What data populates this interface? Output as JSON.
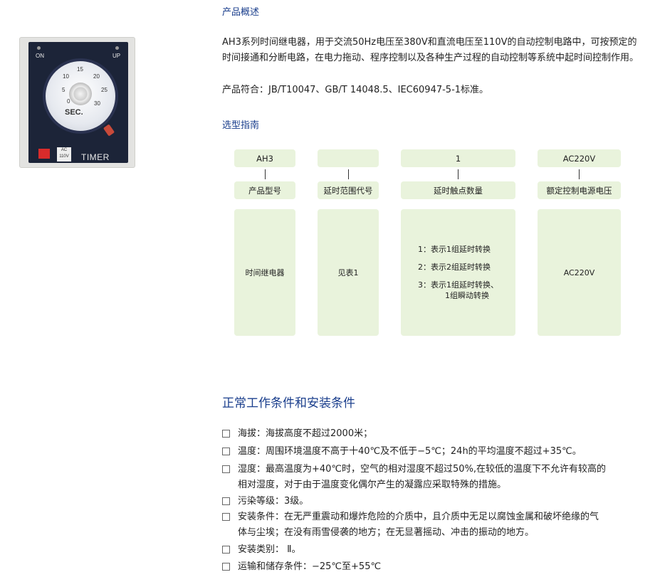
{
  "overview": {
    "heading": "产品概述",
    "description": "AH3系列时间继电器，用于交流50Hz电压至380V和直流电压至110V的自动控制电路中，可按预定的时间接通和分断电路，在电力拖动、程序控制以及各种生产过程的自动控制等系统中起时间控制作用。",
    "standards": "产品符合：JB/T10047、GB/T 14048.5、IEC60947-5-1标准。"
  },
  "product_image": {
    "on_label": "ON",
    "up_label": "UP",
    "dial_numbers": [
      "0",
      "5",
      "10",
      "15",
      "20",
      "25",
      "30"
    ],
    "unit_label": "SEC.",
    "voltage_label": "AC 110V",
    "timer_label": "TIMER"
  },
  "guide": {
    "heading": "选型指南",
    "columns": [
      {
        "code": "AH3",
        "name": "产品型号",
        "detail_lines": [
          "时间继电器"
        ]
      },
      {
        "code": "",
        "name": "延时范围代号",
        "detail_lines": [
          "见表1"
        ]
      },
      {
        "code": "1",
        "name": "延时触点数量",
        "detail_lines": [
          "1：表示1组延时转换",
          "2：表示2组延时转换",
          "3：表示1组延时转换、",
          "1组瞬动转换"
        ]
      },
      {
        "code": "AC220V",
        "name": "额定控制电源电压",
        "detail_lines": [
          "AC220V"
        ]
      }
    ]
  },
  "conditions": {
    "heading": "正常工作条件和安装条件",
    "items": [
      {
        "line1": "海拔：海拔高度不超过2000米；",
        "line2": ""
      },
      {
        "line1": "温度：周围环境温度不高于十40℃及不低于−5℃；24h的平均温度不超过+35℃。",
        "line2": ""
      },
      {
        "line1": "湿度：最高温度为+40℃时，空气的相对湿度不超过50%,在较低的温度下不允许有较高的",
        "line2": "相对湿度，对于由于温度变化偶尔产生的凝露应采取特殊的措施。"
      },
      {
        "line1": "污染等级：3级。",
        "line2": ""
      },
      {
        "line1": "安装条件：在无严重震动和爆炸危险的介质中，且介质中无足以腐蚀金属和破坏绝缘的气",
        "line2": "体与尘埃；在没有雨雪侵袭的地方；在无显著摇动、冲击的振动的地方。"
      },
      {
        "line1": "安装类别：  Ⅱ。",
        "line2": ""
      },
      {
        "line1": "运输和储存条件：−25℃至+55℃",
        "line2": ""
      }
    ]
  }
}
